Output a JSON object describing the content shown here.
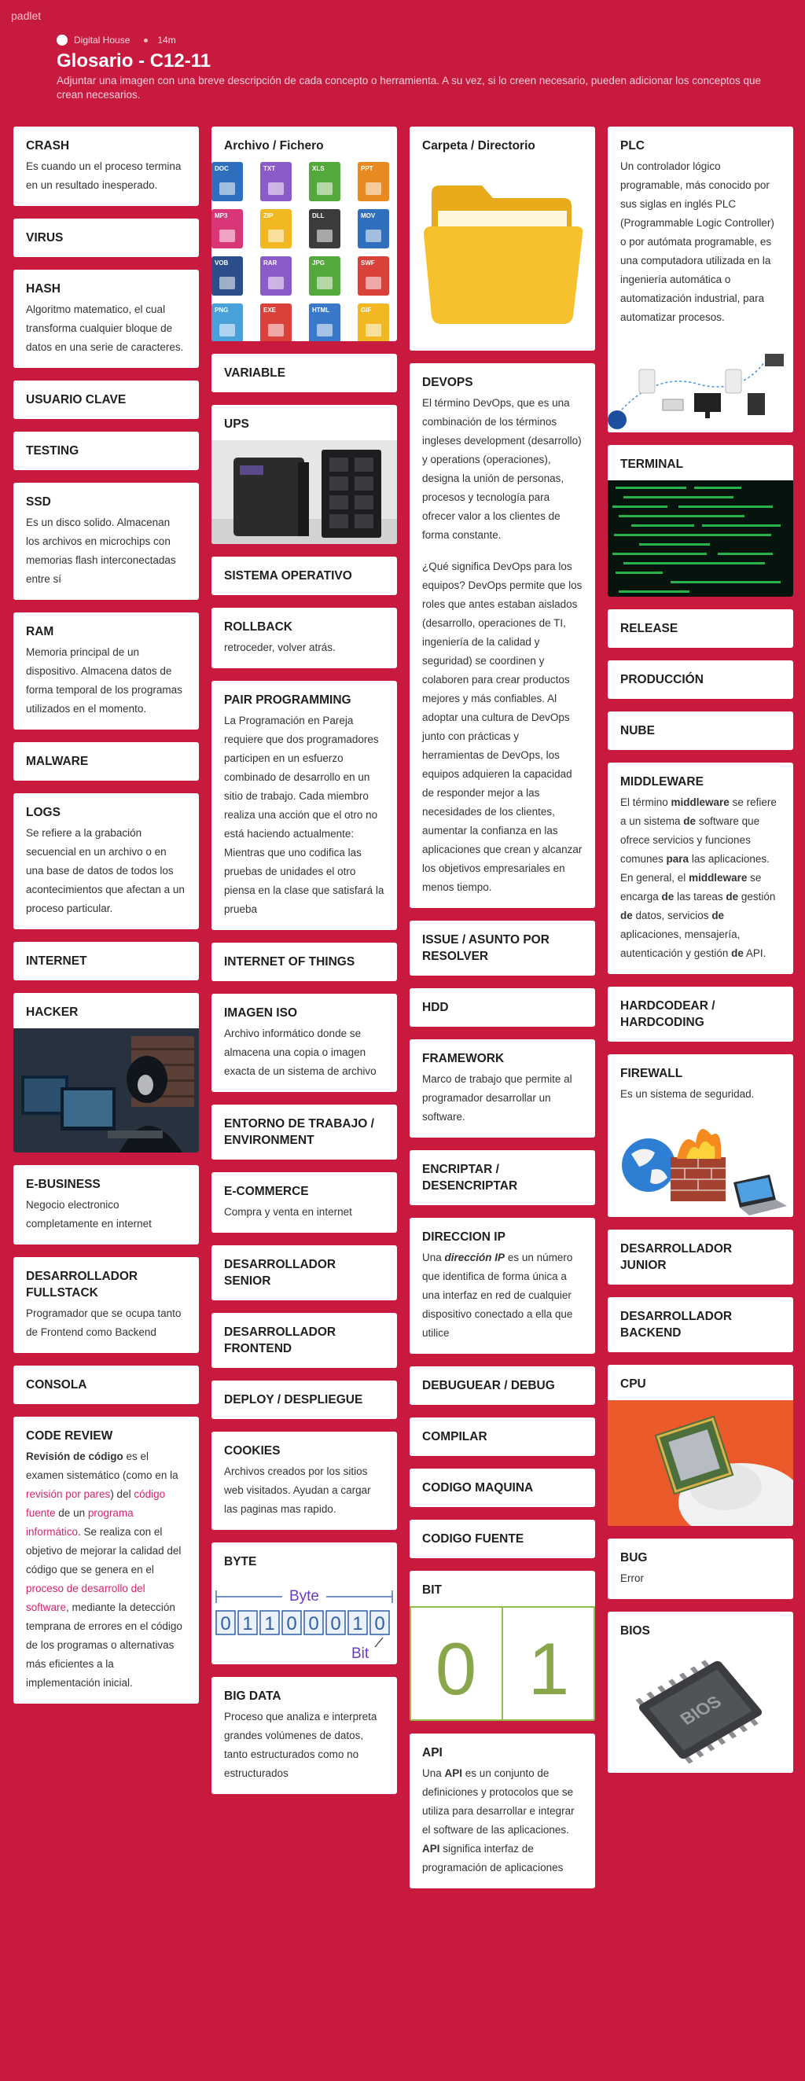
{
  "app": {
    "name": "padlet"
  },
  "header": {
    "author": "Digital House",
    "time": "14m",
    "title": "Glosario - C12-11",
    "subtitle": "Adjuntar una imagen con una breve descripción de cada concepto o herramienta. A su vez, si lo creen necesario, pueden adicionar los conceptos que crean necesarios."
  },
  "col1": {
    "crash": {
      "title": "CRASH",
      "text": "Es cuando un el proceso termina en un resultado inesperado."
    },
    "virus": {
      "title": "VIRUS"
    },
    "hash": {
      "title": "HASH",
      "text": "Algoritmo matematico, el cual transforma cualquier bloque de datos en una serie de caracteres."
    },
    "usuario": {
      "title": "USUARIO CLAVE"
    },
    "testing": {
      "title": "TESTING"
    },
    "ssd": {
      "title": "SSD",
      "text": "Es un disco solido. Almacenan los archivos en microchips con memorias flash interconectadas entre sí"
    },
    "ram": {
      "title": "RAM",
      "text": "Memoria principal de un dispositivo. Almacena datos de forma temporal de los programas utilizados en el momento."
    },
    "malware": {
      "title": "MALWARE"
    },
    "logs": {
      "title": "LOGS",
      "text": "Se refiere a la grabación secuencial en un archivo o en una base de datos de todos los acontecimientos que afectan a un proceso particular."
    },
    "internet": {
      "title": "INTERNET"
    },
    "hacker": {
      "title": "HACKER"
    },
    "ebusiness": {
      "title": "E-BUSINESS",
      "text": "Negocio electronico completamente en internet"
    },
    "fullstack": {
      "title": "DESARROLLADOR FULLSTACK",
      "text": "Programador que se ocupa tanto de  Frontend como Backend"
    },
    "consola": {
      "title": "CONSOLA"
    },
    "codereview": {
      "title": "CODE REVIEW",
      "t1": "Revisión de código",
      "t2": " es el examen sistemático (como en la ",
      "l1": "revisión por pares",
      "t3": ") del ",
      "l2": "código fuente",
      "t4": " de un ",
      "l3": "programa informático",
      "t5": ". Se realiza con el objetivo de mejorar la calidad del código que se genera en el ",
      "l4": "proceso de desarrollo del software",
      "t6": ", mediante la detección temprana de errores en el código de los programas o alternativas más eficientes a la implementación inicial."
    }
  },
  "col2": {
    "archivo": {
      "title": "Archivo / Fichero",
      "files": [
        "DOC",
        "TXT",
        "XLS",
        "PPT",
        "MP3",
        "ZIP",
        "DLL",
        "MOV",
        "VOB",
        "RAR",
        "JPG",
        "SWF",
        "PNG",
        "EXE",
        "HTML",
        "GIF"
      ],
      "colors": [
        "#2f6fbd",
        "#8b5cc7",
        "#55a83c",
        "#e88a1f",
        "#d9367a",
        "#f2b822",
        "#3c3c3c",
        "#2f6fbd",
        "#2c4f8c",
        "#8b5cc7",
        "#55a83c",
        "#d9423b",
        "#4aa0d9",
        "#d9423b",
        "#3a78c9",
        "#f2b822"
      ]
    },
    "variable": {
      "title": "VARIABLE"
    },
    "ups": {
      "title": "UPS"
    },
    "so": {
      "title": "SISTEMA OPERATIVO"
    },
    "rollback": {
      "title": "ROLLBACK",
      "text": "retroceder, volver atrás."
    },
    "pair": {
      "title": "PAIR PROGRAMMING",
      "text": "La Programación en Pareja requiere que dos programadores participen en un esfuerzo combinado de desarrollo en un sitio de trabajo. Cada miembro realiza una acción que el otro no está haciendo actualmente: Mientras que uno codifica las pruebas de unidades el otro piensa en la clase que satisfará la prueba"
    },
    "iot": {
      "title": "INTERNET OF THINGS"
    },
    "iso": {
      "title": "IMAGEN ISO",
      "text": "Archivo informático donde se almacena una copia o imagen exacta de un sistema de archivo"
    },
    "entorno": {
      "title": "ENTORNO DE TRABAJO / ENVIRONMENT"
    },
    "ecommerce": {
      "title": "E-COMMERCE",
      "text": "Compra y venta en internet"
    },
    "senior": {
      "title": "DESARROLLADOR SENIOR"
    },
    "frontend": {
      "title": "DESARROLLADOR FRONTEND"
    },
    "deploy": {
      "title": "DEPLOY / DESPLIEGUE"
    },
    "cookies": {
      "title": "COOKIES",
      "text": "Archivos creados por los sitios web visitados. Ayudan a cargar las paginas mas rapido."
    },
    "byte": {
      "title": "BYTE",
      "label": "Byte",
      "bits": [
        "0",
        "1",
        "1",
        "0",
        "0",
        "0",
        "1",
        "0"
      ],
      "bitlabel": "Bit"
    },
    "bigdata": {
      "title": "BIG DATA",
      "text": " Proceso que analiza e interpreta grandes volúmenes de datos, tanto estructurados como no estructurados"
    }
  },
  "col3": {
    "carpeta": {
      "title": "Carpeta / Directorio"
    },
    "devops": {
      "title": "DEVOPS",
      "p1": "El término DevOps, que es una combinación de los términos ingleses development (desarrollo) y operations (operaciones), designa la unión de personas, procesos y tecnología para ofrecer valor a los clientes de forma constante.",
      "p2": "¿Qué significa DevOps para los equipos? DevOps permite que los roles que antes estaban aislados (desarrollo, operaciones de TI, ingeniería de la calidad y seguridad) se coordinen y colaboren para crear productos mejores y más confiables. Al adoptar una cultura de DevOps junto con prácticas y herramientas de DevOps, los equipos adquieren la capacidad de responder mejor a las necesidades de los clientes, aumentar la confianza en las aplicaciones que crean y alcanzar los objetivos empresariales en menos tiempo."
    },
    "issue": {
      "title": "ISSUE / ASUNTO POR RESOLVER"
    },
    "hdd": {
      "title": "HDD"
    },
    "framework": {
      "title": "FRAMEWORK",
      "text": "Marco de trabajo que permite al programador desarrollar un software."
    },
    "encriptar": {
      "title": "ENCRIPTAR / DESENCRIPTAR"
    },
    "ip": {
      "title": "DIRECCION IP",
      "b": "dirección IP",
      "t1": "Una ",
      "t2": " es un número que identifica de forma única a una interfaz en red de cualquier dispositivo conectado a ella que utilice"
    },
    "debug": {
      "title": "DEBUGUEAR / DEBUG"
    },
    "compilar": {
      "title": "COMPILAR"
    },
    "maquina": {
      "title": "CODIGO MAQUINA"
    },
    "fuente": {
      "title": "CODIGO FUENTE"
    },
    "bit": {
      "title": "BIT",
      "zero": "0",
      "one": "1"
    },
    "api": {
      "title": "API",
      "t1": "Una ",
      "b1": "API",
      "t2": " es un conjunto de definiciones y protocolos que se utiliza para desarrollar e integrar el software de las aplicaciones. ",
      "b2": "API",
      "t3": " significa interfaz de programación de aplicaciones"
    }
  },
  "col4": {
    "plc": {
      "title": "PLC",
      "text": "Un controlador lógico programable, más conocido por sus siglas en inglés PLC (Programmable Logic Controller) o por autómata programable, es una computadora utilizada en la ingeniería automática o automatización industrial, para automatizar procesos."
    },
    "terminal": {
      "title": "TERMINAL"
    },
    "release": {
      "title": "RELEASE"
    },
    "produccion": {
      "title": "PRODUCCIÓN"
    },
    "nube": {
      "title": "NUBE"
    },
    "middleware": {
      "title": "MIDDLEWARE",
      "t1": "El término ",
      "b1": "middleware",
      "t2": " se refiere a un sistema ",
      "b2": "de",
      "t3": " software que ofrece servicios y funciones comunes ",
      "b3": "para",
      "t4": " las aplicaciones. En general, el ",
      "b4": "middleware",
      "t5": " se encarga ",
      "b5": "de",
      "t6": " las tareas ",
      "b6": "de",
      "t7": " gestión ",
      "b7": "de",
      "t8": " datos, servicios ",
      "b8": "de",
      "t9": " aplicaciones, mensajería, autenticación y gestión ",
      "b9": "de",
      "t10": " API."
    },
    "hardcodear": {
      "title": "HARDCODEAR / HARDCODING"
    },
    "firewall": {
      "title": "FIREWALL",
      "text": "Es un sistema de seguridad."
    },
    "junior": {
      "title": "DESARROLLADOR JUNIOR"
    },
    "backend": {
      "title": "DESARROLLADOR BACKEND"
    },
    "cpu": {
      "title": "CPU"
    },
    "bug": {
      "title": "BUG",
      "text": "Error"
    },
    "bios": {
      "title": "BIOS",
      "chip": "BIOS"
    }
  }
}
